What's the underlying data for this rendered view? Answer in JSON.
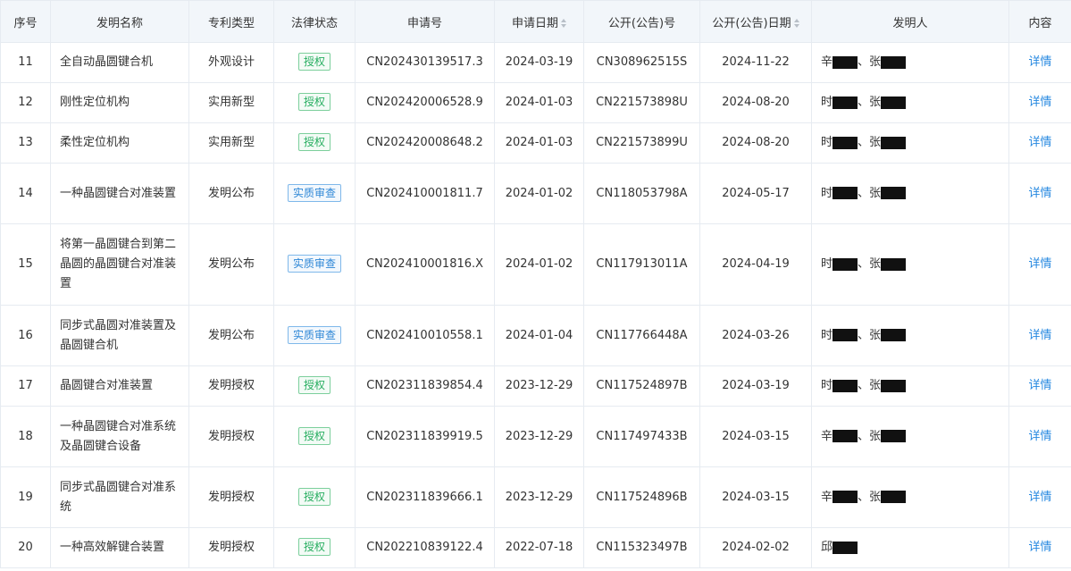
{
  "columns": [
    "序号",
    "发明名称",
    "专利类型",
    "法律状态",
    "申请号",
    "申请日期",
    "公开(公告)号",
    "公开(公告)日期",
    "发明人",
    "内容"
  ],
  "sortable": [
    "申请日期",
    "公开(公告)日期"
  ],
  "colors": {
    "granted": "#27ae60",
    "review": "#2c86d6",
    "link": "#2688e0",
    "header_bg": "#f2f6fa"
  },
  "rows": [
    {
      "no": "11",
      "title": "全自动晶圆键合机",
      "type": "外观设计",
      "status": "授权",
      "status_kind": "granted",
      "app_no": "CN202430139517.3",
      "app_date": "2024-03-19",
      "pub_no": "CN308962515S",
      "pub_date": "2024-11-22",
      "inventor_a": "辛",
      "inventor_sep": "、",
      "inventor_b": "张",
      "detail": "详情"
    },
    {
      "no": "12",
      "title": "刚性定位机构",
      "type": "实用新型",
      "status": "授权",
      "status_kind": "granted",
      "app_no": "CN202420006528.9",
      "app_date": "2024-01-03",
      "pub_no": "CN221573898U",
      "pub_date": "2024-08-20",
      "inventor_a": "时",
      "inventor_sep": "、",
      "inventor_b": "张",
      "detail": "详情"
    },
    {
      "no": "13",
      "title": "柔性定位机构",
      "type": "实用新型",
      "status": "授权",
      "status_kind": "granted",
      "app_no": "CN202420008648.2",
      "app_date": "2024-01-03",
      "pub_no": "CN221573899U",
      "pub_date": "2024-08-20",
      "inventor_a": "时",
      "inventor_sep": "、",
      "inventor_b": "张",
      "detail": "详情"
    },
    {
      "no": "14",
      "title": "一种晶圆键合对准装置",
      "type": "发明公布",
      "status": "实质审查",
      "status_kind": "review",
      "app_no": "CN202410001811.7",
      "app_date": "2024-01-02",
      "pub_no": "CN118053798A",
      "pub_date": "2024-05-17",
      "inventor_a": "时",
      "inventor_sep": "、",
      "inventor_b": "张",
      "detail": "详情"
    },
    {
      "no": "15",
      "title": "将第一晶圆键合到第二晶圆的晶圆键合对准装置",
      "type": "发明公布",
      "status": "实质审查",
      "status_kind": "review",
      "app_no": "CN202410001816.X",
      "app_date": "2024-01-02",
      "pub_no": "CN117913011A",
      "pub_date": "2024-04-19",
      "inventor_a": "时",
      "inventor_sep": "、",
      "inventor_b": "张",
      "detail": "详情"
    },
    {
      "no": "16",
      "title": "同步式晶圆对准装置及晶圆键合机",
      "type": "发明公布",
      "status": "实质审查",
      "status_kind": "review",
      "app_no": "CN202410010558.1",
      "app_date": "2024-01-04",
      "pub_no": "CN117766448A",
      "pub_date": "2024-03-26",
      "inventor_a": "时",
      "inventor_sep": "、",
      "inventor_b": "张",
      "detail": "详情"
    },
    {
      "no": "17",
      "title": "晶圆键合对准装置",
      "type": "发明授权",
      "status": "授权",
      "status_kind": "granted",
      "app_no": "CN202311839854.4",
      "app_date": "2023-12-29",
      "pub_no": "CN117524897B",
      "pub_date": "2024-03-19",
      "inventor_a": "时",
      "inventor_sep": "、",
      "inventor_b": "张",
      "detail": "详情"
    },
    {
      "no": "18",
      "title": "一种晶圆键合对准系统及晶圆键合设备",
      "type": "发明授权",
      "status": "授权",
      "status_kind": "granted",
      "app_no": "CN202311839919.5",
      "app_date": "2023-12-29",
      "pub_no": "CN117497433B",
      "pub_date": "2024-03-15",
      "inventor_a": "辛",
      "inventor_sep": "、",
      "inventor_b": "张",
      "detail": "详情"
    },
    {
      "no": "19",
      "title": "同步式晶圆键合对准系统",
      "type": "发明授权",
      "status": "授权",
      "status_kind": "granted",
      "app_no": "CN202311839666.1",
      "app_date": "2023-12-29",
      "pub_no": "CN117524896B",
      "pub_date": "2024-03-15",
      "inventor_a": "辛",
      "inventor_sep": "、",
      "inventor_b": "张",
      "detail": "详情"
    },
    {
      "no": "20",
      "title": "一种高效解键合装置",
      "type": "发明授权",
      "status": "授权",
      "status_kind": "granted",
      "app_no": "CN202210839122.4",
      "app_date": "2022-07-18",
      "pub_no": "CN115323497B",
      "pub_date": "2024-02-02",
      "inventor_a": "邱",
      "inventor_sep": "",
      "inventor_b": "",
      "detail": "详情"
    }
  ]
}
